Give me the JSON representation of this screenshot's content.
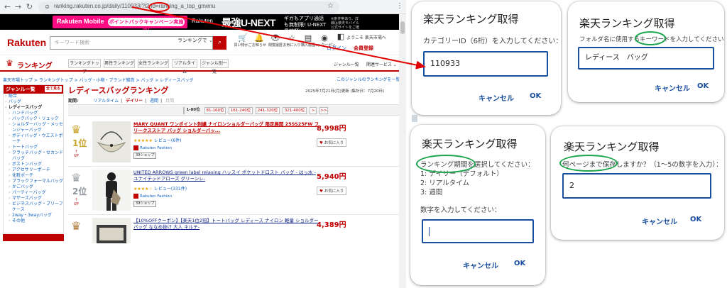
{
  "browser": {
    "url": "ranking.rakuten.co.jp/daily/110933/?l2-id=ranking_a_top_gmenu",
    "ad": {
      "mobile_logo": "Rakuten Mobile",
      "mobile_pill": "ポイントバックキャンペーン実施中!",
      "unext_brand": "Rakuten",
      "unext_title": "最強U-NEXT",
      "unext_sub": "ギガもアプリ通話も無制限! U-NEXT見放題!",
      "unext_note": "※条件等あり、詳細は楽天モバイル公式サイトをご確認ください"
    },
    "header": {
      "logo": "Rakuten",
      "search_placeholder": "キーワード検索",
      "search_select": "ランキングで ⌄",
      "icons": [
        {
          "g": "🛒",
          "t": "買い物かご"
        },
        {
          "g": "🔔",
          "t": "お知らせ"
        },
        {
          "g": "👁",
          "t": "閲覧履歴"
        },
        {
          "g": "☆",
          "t": "お気に入り"
        },
        {
          "g": "▤",
          "t": "購入履歴"
        },
        {
          "g": "◉",
          "t": "my クーポン"
        },
        {
          "g": "◧",
          "t": "ログイン"
        }
      ],
      "welcome": "ようこそ 楽天市場へ",
      "login": "ログイン",
      "register": "会員登録"
    },
    "rankbar": {
      "title": "ランキング",
      "tabs": [
        "ランキングトップ",
        "男性ランキング",
        "女性ランキング",
        "リアルタイム",
        "ジャンル別一覧"
      ],
      "genre_list": "ジャンル一覧",
      "related": "関連サービス ⌄"
    },
    "breadcrumb": "楽天市場トップ > ランキングトップ > バッグ・小物・ブランド雑貨 > バッグ > レディースバッグ",
    "other_genre": "このジャンルのランキングを一覧 ▸",
    "sidebar": {
      "head": "ジャンル一覧",
      "all": "全て見る",
      "items": [
        {
          "label": "総合",
          "level": 0,
          "bold": false
        },
        {
          "label": "バッグ",
          "level": 0,
          "bold": false
        },
        {
          "label": "レディースバッグ",
          "level": 0,
          "bold": true
        },
        {
          "label": "ハンドバッグ",
          "level": 1,
          "bold": false
        },
        {
          "label": "バックパック・リュック",
          "level": 1,
          "bold": false
        },
        {
          "label": "ショルダーバッグ・メッセンジャーバッグ",
          "level": 1,
          "bold": false
        },
        {
          "label": "ボディバッグ・ウエストポーチ",
          "level": 1,
          "bold": false
        },
        {
          "label": "トートバッグ",
          "level": 1,
          "bold": false
        },
        {
          "label": "クラッチバッグ・セカンドバッグ",
          "level": 1,
          "bold": false
        },
        {
          "label": "ボストンバッグ",
          "level": 1,
          "bold": false
        },
        {
          "label": "アクセサリーポーチ",
          "level": 1,
          "bold": false
        },
        {
          "label": "化粧ポーチ",
          "level": 1,
          "bold": false
        },
        {
          "label": "ブラックフォーマルバッグ",
          "level": 1,
          "bold": false
        },
        {
          "label": "かごバッグ",
          "level": 1,
          "bold": false
        },
        {
          "label": "パーティーバッグ",
          "level": 1,
          "bold": false
        },
        {
          "label": "マザーズバッグ",
          "level": 1,
          "bold": false
        },
        {
          "label": "ビジネスバッグ・ブリーフケース",
          "level": 1,
          "bold": false
        },
        {
          "label": "2way・3wayバッグ",
          "level": 1,
          "bold": false
        },
        {
          "label": "その他",
          "level": 1,
          "bold": false
        }
      ]
    },
    "content": {
      "title": "レディースバッグランキング",
      "updated": "2025年7月21日(月)更新 (集計日：7月20日)",
      "period_label": "期間:",
      "periods": [
        {
          "label": "リアルタイム",
          "state": "link"
        },
        {
          "label": "デイリー",
          "state": "selected"
        },
        {
          "label": "週間",
          "state": "link"
        },
        {
          "label": "月間",
          "state": "disabled"
        }
      ],
      "pages": [
        "1-80位",
        "81-160位",
        "161-240位",
        "241-320位",
        "321-400位",
        ">",
        ">>"
      ],
      "items": [
        {
          "rank": "1位",
          "updown": "UP",
          "name": "MARY QUANT ワンポイント刺繍 ナイロンショルダーバッグ 限定展開 25SS25FW フリークスストア バッグ ショルダーバッ...",
          "stars": "★★★★★",
          "reviews": "レビュー(6件)",
          "shop": "Rakuten Fashion",
          "shop_btn": "39ショップ",
          "price": "8,998円",
          "fav": "お気に入り"
        },
        {
          "rank": "2位",
          "updown": "UP",
          "name": "UNITED ARROWS green label relaxing ハッスイ ポケットドロスト バッグ - はっ水 - ユナイテッドアローズ グリーンレ-",
          "stars": "★★★★☆",
          "reviews": "レビュー(331件)",
          "shop": "Rakuten Fashion",
          "shop_btn": "39ショップ",
          "price": "5,940円",
          "fav": "お気に入り"
        },
        {
          "rank": "",
          "updown": "",
          "name": "【10%OFFクーポン】【楽天1位2冠】トートバッグ レディース ナイロン 軽量 ショルダーバッグ ななめ掛け 大人 キルテ-",
          "stars": "",
          "reviews": "",
          "shop": "",
          "shop_btn": "",
          "price": "4,389円",
          "fav": ""
        }
      ]
    }
  },
  "dialogs": {
    "d1": {
      "title": "楽天ランキング取得",
      "message": "カテゴリーID（6桁）を入力してください：",
      "value": "110933",
      "cancel": "キャンセル",
      "ok": "OK"
    },
    "d2": {
      "title": "楽天ランキング取得",
      "message": "フォルダ名に使用するキーワードを入力してください：",
      "value": "レディース　バッグ",
      "cancel": "キャンセル",
      "ok": "OK"
    },
    "d3": {
      "title": "楽天ランキング取得",
      "message_lines": [
        "ランキング期間を選択してください：",
        "1: デイリー（デフォルト）",
        "2: リアルタイム",
        "3: 週間"
      ],
      "prompt": "数字を入力してください：",
      "value": "",
      "cancel": "キャンセル",
      "ok": "OK"
    },
    "d4": {
      "title": "楽天ランキング取得",
      "message": "何ページまで保存しますか？（1〜5の数字を入力）：",
      "value": "2",
      "cancel": "キャンセル",
      "ok": "OK"
    }
  },
  "colors": {
    "rakuten_red": "#bf0000",
    "annotation_red": "#e00000",
    "annotation_green": "#1aa34a",
    "dialog_blue": "#1a4fa0"
  }
}
